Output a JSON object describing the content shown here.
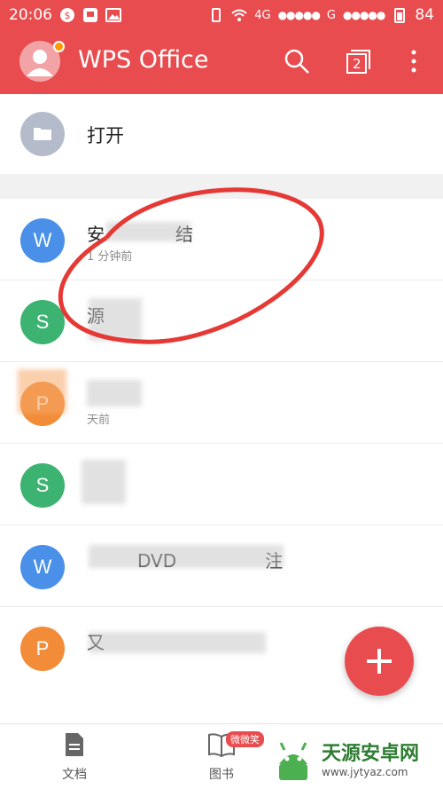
{
  "status_bar": {
    "time": "20:06",
    "network_left": "4G",
    "network_right": "G",
    "signal_dots": "●●●●●",
    "battery": "84"
  },
  "app_bar": {
    "title": "WPS Office",
    "window_count": "2"
  },
  "open_row": {
    "label": "打开"
  },
  "documents": [
    {
      "type": "writer",
      "icon_letter": "W",
      "color": "#4a90e8",
      "name": "安　　　　结",
      "time": "1 分钟前"
    },
    {
      "type": "spreadsheet",
      "icon_letter": "S",
      "color": "#3cb371",
      "name": "源",
      "time": ""
    },
    {
      "type": "pdf",
      "icon_letter": "P",
      "color": "#f28c38",
      "name": "",
      "time": "天前"
    },
    {
      "type": "spreadsheet",
      "icon_letter": "S",
      "color": "#3cb371",
      "name": "",
      "time": ""
    },
    {
      "type": "writer",
      "icon_letter": "W",
      "color": "#4a90e8",
      "name": "DVD　　　　　注",
      "time": ""
    },
    {
      "type": "presentation",
      "icon_letter": "P",
      "color": "#f28c38",
      "name": "又",
      "time": ""
    }
  ],
  "bottom_tabs": {
    "docs": "文档",
    "books": "图书",
    "books_badge": "微微笑"
  },
  "watermark": {
    "name": "天源安卓网",
    "url": "www.jytyaz.com"
  },
  "colors": {
    "accent": "#e84c4f",
    "writer": "#4a90e8",
    "spreadsheet": "#3cb371",
    "presentation": "#f28c38",
    "folder": "#b4bccb"
  }
}
